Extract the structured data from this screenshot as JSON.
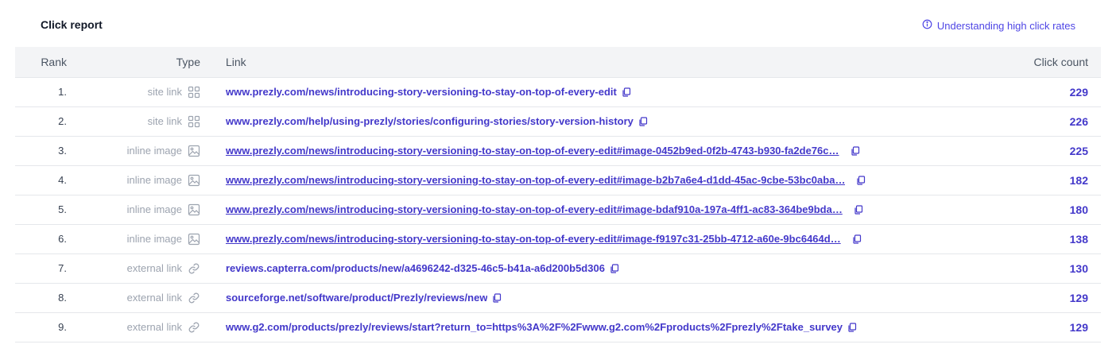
{
  "header": {
    "title": "Click report",
    "help_link": "Understanding high click rates"
  },
  "table": {
    "columns": {
      "rank": "Rank",
      "type": "Type",
      "link": "Link",
      "count": "Click count"
    },
    "rows": [
      {
        "rank": "1.",
        "type": "site link",
        "icon": "grid-icon",
        "link": "www.prezly.com/news/introducing-story-versioning-to-stay-on-top-of-every-edit",
        "count": "229"
      },
      {
        "rank": "2.",
        "type": "site link",
        "icon": "grid-icon",
        "link": "www.prezly.com/help/using-prezly/stories/configuring-stories/story-version-history",
        "count": "226"
      },
      {
        "rank": "3.",
        "type": "inline image",
        "icon": "image-icon",
        "link": "www.prezly.com/news/introducing-story-versioning-to-stay-on-top-of-every-edit#image-0452b9ed-0f2b-4743-b930-fa2de76c…",
        "count": "225"
      },
      {
        "rank": "4.",
        "type": "inline image",
        "icon": "image-icon",
        "link": "www.prezly.com/news/introducing-story-versioning-to-stay-on-top-of-every-edit#image-b2b7a6e4-d1dd-45ac-9cbe-53bc0aba…",
        "count": "182"
      },
      {
        "rank": "5.",
        "type": "inline image",
        "icon": "image-icon",
        "link": "www.prezly.com/news/introducing-story-versioning-to-stay-on-top-of-every-edit#image-bdaf910a-197a-4ff1-ac83-364be9bda…",
        "count": "180"
      },
      {
        "rank": "6.",
        "type": "inline image",
        "icon": "image-icon",
        "link": "www.prezly.com/news/introducing-story-versioning-to-stay-on-top-of-every-edit#image-f9197c31-25bb-4712-a60e-9bc6464d…",
        "count": "138"
      },
      {
        "rank": "7.",
        "type": "external link",
        "icon": "chain-link-icon",
        "link": "reviews.capterra.com/products/new/a4696242-d325-46c5-b41a-a6d200b5d306",
        "count": "130"
      },
      {
        "rank": "8.",
        "type": "external link",
        "icon": "chain-link-icon",
        "link": "sourceforge.net/software/product/Prezly/reviews/new",
        "count": "129"
      },
      {
        "rank": "9.",
        "type": "external link",
        "icon": "chain-link-icon",
        "link": "www.g2.com/products/prezly/reviews/start?return_to=https%3A%2F%2Fwww.g2.com%2Fproducts%2Fprezly%2Ftake_survey",
        "count": "129"
      }
    ]
  },
  "colors": {
    "accent": "#4338ca",
    "muted": "#9ca3af",
    "header_bg": "#f3f4f6",
    "border": "#e5e7eb"
  }
}
